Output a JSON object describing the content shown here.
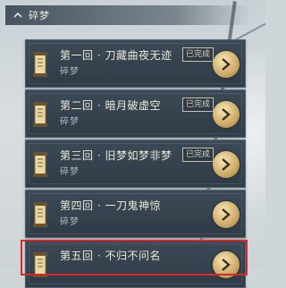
{
  "header": {
    "title": "碎梦"
  },
  "chapters": [
    {
      "title": "第一回 · 刀藏曲夜无迹",
      "subtitle": "碎梦",
      "status": "已完成"
    },
    {
      "title": "第二回 · 暗月破虚空",
      "subtitle": "碎梦",
      "status": "已完成"
    },
    {
      "title": "第三回 · 旧梦如梦非梦",
      "subtitle": "碎梦",
      "status": "已完成"
    },
    {
      "title": "第四回 · 一刀鬼神惊",
      "subtitle": "碎梦",
      "status": ""
    },
    {
      "title": "第五回 · 不归不问名",
      "subtitle": "",
      "status": ""
    }
  ],
  "colors": {
    "highlight": "#d42a2a",
    "panel": "#34414d",
    "accent": "#c9a560"
  }
}
